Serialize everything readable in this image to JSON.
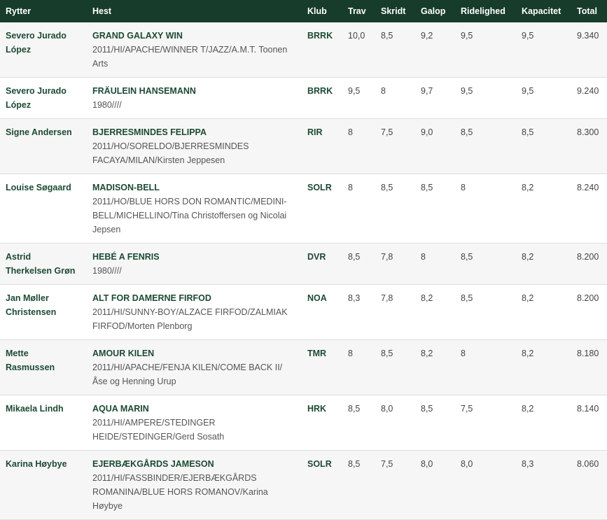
{
  "headers": {
    "rider": "Rytter",
    "horse": "Hest",
    "club": "Klub",
    "trav": "Trav",
    "skridt": "Skridt",
    "galop": "Galop",
    "ridelighed": "Ridelighed",
    "kapacitet": "Kapacitet",
    "total": "Total"
  },
  "rows": [
    {
      "rider": "Severo Jurado López",
      "horse": "GRAND GALAXY WIN",
      "info": "2011/HI/APACHE/WINNER T/JAZZ/A.M.T. Toonen Arts",
      "club": "BRRK",
      "trav": "10,0",
      "skridt": "8,5",
      "galop": "9,2",
      "ridelighed": "9,5",
      "kapacitet": "9,5",
      "total": "9.340"
    },
    {
      "rider": "Severo Jurado López",
      "horse": "FRÄULEIN HANSEMANN",
      "info": "1980////",
      "club": "BRRK",
      "trav": "9,5",
      "skridt": "8",
      "galop": "9,7",
      "ridelighed": "9,5",
      "kapacitet": "9,5",
      "total": "9.240"
    },
    {
      "rider": "Signe Andersen",
      "horse": "BJERRESMINDES FELIPPA",
      "info": "2011/HO/SORELDO/BJERRESMINDES FACAYA/MILAN/Kirsten Jeppesen",
      "club": "RIR",
      "trav": "8",
      "skridt": "7,5",
      "galop": "9,0",
      "ridelighed": "8,5",
      "kapacitet": "8,5",
      "total": "8.300"
    },
    {
      "rider": "Louise Søgaard",
      "horse": "MADISON-BELL",
      "info": "2011/HO/BLUE HORS DON ROMANTIC/MEDINI-BELL/MICHELLINO/Tina Christoffersen og Nicolai Jepsen",
      "club": "SOLR",
      "trav": "8",
      "skridt": "8,5",
      "galop": "8,5",
      "ridelighed": "8",
      "kapacitet": "8,2",
      "total": "8.240"
    },
    {
      "rider": "Astrid Therkelsen Grøn",
      "horse": "HEBÉ A FENRIS",
      "info": "1980////",
      "club": "DVR",
      "trav": "8,5",
      "skridt": "7,8",
      "galop": "8",
      "ridelighed": "8,5",
      "kapacitet": "8,2",
      "total": "8.200"
    },
    {
      "rider": "Jan Møller Christensen",
      "horse": "ALT FOR DAMERNE FIRFOD",
      "info": "2011/HI/SUNNY-BOY/ALZACE FIRFOD/ZALMIAK FIRFOD/Morten Plenborg",
      "club": "NOA",
      "trav": "8,3",
      "skridt": "7,8",
      "galop": "8,2",
      "ridelighed": "8,5",
      "kapacitet": "8,2",
      "total": "8.200"
    },
    {
      "rider": "Mette Rasmussen",
      "horse": "AMOUR KILEN",
      "info": "2011/HI/APACHE/FENJA KILEN/COME BACK II/ Åse og Henning Urup",
      "club": "TMR",
      "trav": "8",
      "skridt": "8,5",
      "galop": "8,2",
      "ridelighed": "8",
      "kapacitet": "8,2",
      "total": "8.180"
    },
    {
      "rider": "Mikaela Lindh",
      "horse": "AQUA MARIN",
      "info": "2011/HI/AMPERE/STEDINGER HEIDE/STEDINGER/Gerd Sosath",
      "club": "HRK",
      "trav": "8,5",
      "skridt": "8,0",
      "galop": "8,5",
      "ridelighed": "7,5",
      "kapacitet": "8,2",
      "total": "8.140"
    },
    {
      "rider": "Karina Høybye",
      "horse": "EJERBÆKGÅRDS JAMESON",
      "info": "2011/HI/FASSBINDER/EJERBÆKGÅRDS ROMANINA/BLUE HORS ROMANOV/Karina Høybye",
      "club": "SOLR",
      "trav": "8,5",
      "skridt": "7,5",
      "galop": "8,0",
      "ridelighed": "8,0",
      "kapacitet": "8,3",
      "total": "8.060"
    }
  ]
}
